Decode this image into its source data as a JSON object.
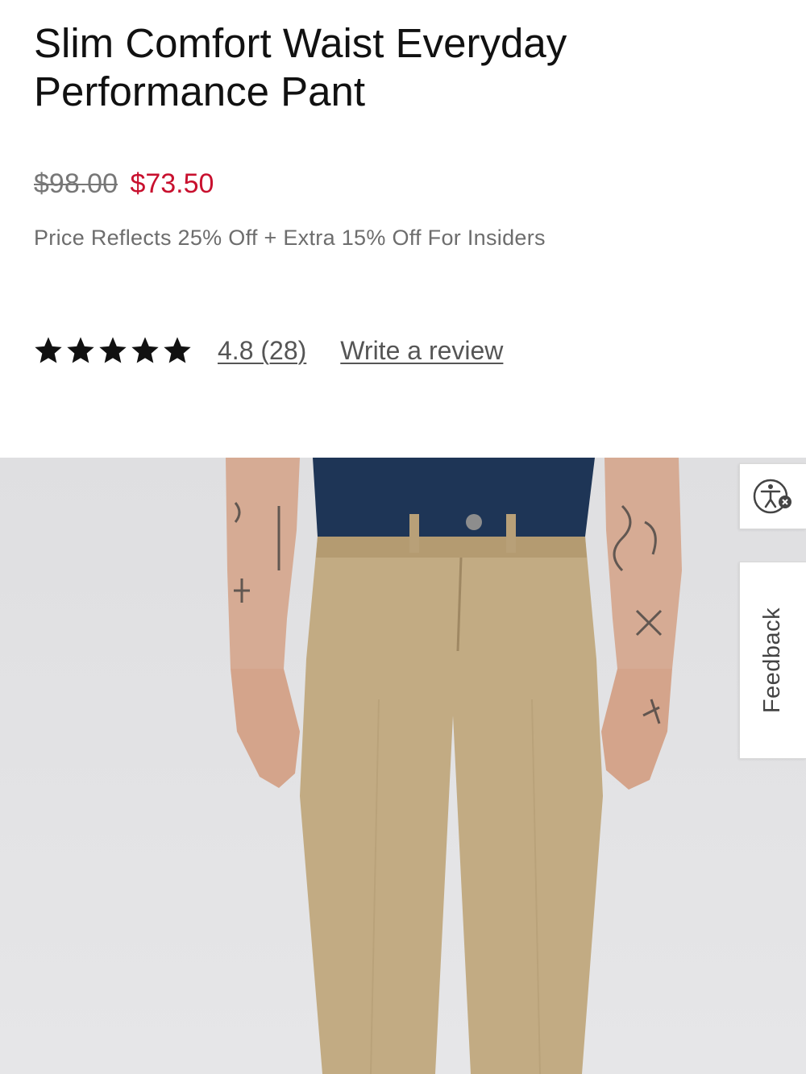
{
  "product": {
    "title": "Slim Comfort Waist Everyday Performance Pant",
    "original_price": "$98.00",
    "sale_price": "$73.50",
    "promo_text": "Price Reflects 25% Off + Extra 15% Off For Insiders"
  },
  "rating": {
    "stars": 5,
    "score_count_text": "4.8 (28)",
    "write_review_label": "Write a review"
  },
  "side_tabs": {
    "feedback_label": "Feedback",
    "accessibility_icon": "accessibility-icon"
  },
  "colors": {
    "sale_price": "#c8102e",
    "pants": "#c2ab83",
    "shirt": "#1e3556",
    "background_photo": "#e2e2e4"
  }
}
